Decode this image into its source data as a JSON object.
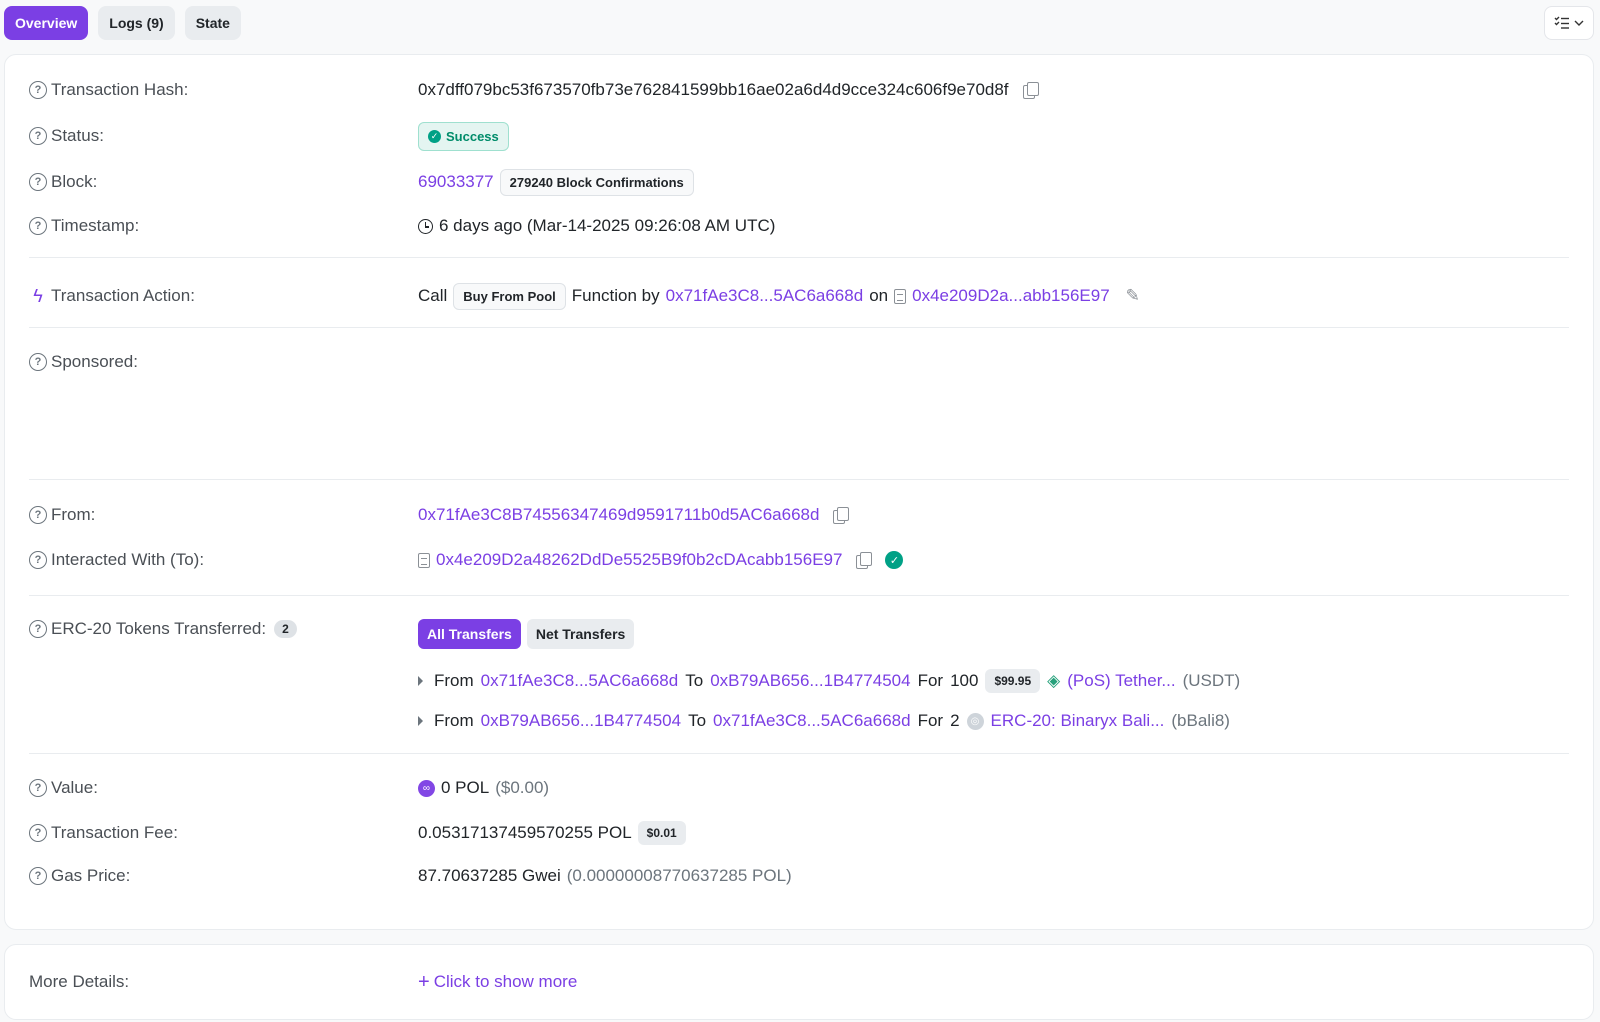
{
  "tabs": [
    {
      "label": "Overview"
    },
    {
      "label": "Logs (9)"
    },
    {
      "label": "State"
    }
  ],
  "colors": {
    "accent": "#7b3fe4",
    "success": "#00a186"
  },
  "overview": {
    "tx_hash": {
      "label": "Transaction Hash:",
      "value": "0x7dff079bc53f673570fb73e762841599bb16ae02a6d4d9cce324c606f9e70d8f"
    },
    "status": {
      "label": "Status:",
      "value": "Success"
    },
    "block": {
      "label": "Block:",
      "number": "69033377",
      "confirmations": "279240 Block Confirmations"
    },
    "timestamp": {
      "label": "Timestamp:",
      "value": "6 days ago (Mar-14-2025 09:26:08 AM UTC)"
    },
    "action": {
      "label": "Transaction Action:",
      "call": "Call",
      "function_name": "Buy From Pool",
      "function_by": "Function by",
      "caller": "0x71fAe3C8...5AC6a668d",
      "on": "on",
      "contract": "0x4e209D2a...abb156E97"
    },
    "sponsored": {
      "label": "Sponsored:"
    },
    "from": {
      "label": "From:",
      "value": "0x71fAe3C8B74556347469d9591711b0d5AC6a668d"
    },
    "to": {
      "label": "Interacted With (To):",
      "value": "0x4e209D2a48262DdDe5525B9f0b2cDAcabb156E97"
    },
    "erc20": {
      "label": "ERC-20 Tokens Transferred:",
      "count": "2",
      "btn_all": "All Transfers",
      "btn_net": "Net Transfers",
      "transfers": [
        {
          "from_kw": "From",
          "from": "0x71fAe3C8...5AC6a668d",
          "to_kw": "To",
          "to": "0xB79AB656...1B4774504",
          "for_kw": "For",
          "amount": "100",
          "usd": "$99.95",
          "token": "(PoS) Tether...",
          "symbol": "(USDT)"
        },
        {
          "from_kw": "From",
          "from": "0xB79AB656...1B4774504",
          "to_kw": "To",
          "to": "0x71fAe3C8...5AC6a668d",
          "for_kw": "For",
          "amount": "2",
          "token": "ERC-20: Binaryx Bali...",
          "symbol": "(bBali8)"
        }
      ]
    },
    "value": {
      "label": "Value:",
      "amount": "0 POL",
      "usd": "($0.00)"
    },
    "fee": {
      "label": "Transaction Fee:",
      "amount": "0.05317137459570255 POL",
      "usd": "$0.01"
    },
    "gas": {
      "label": "Gas Price:",
      "amount": "87.70637285 Gwei",
      "pol": "(0.00000008770637285 POL)"
    }
  },
  "more": {
    "label": "More Details:",
    "link": "Click to show more"
  }
}
